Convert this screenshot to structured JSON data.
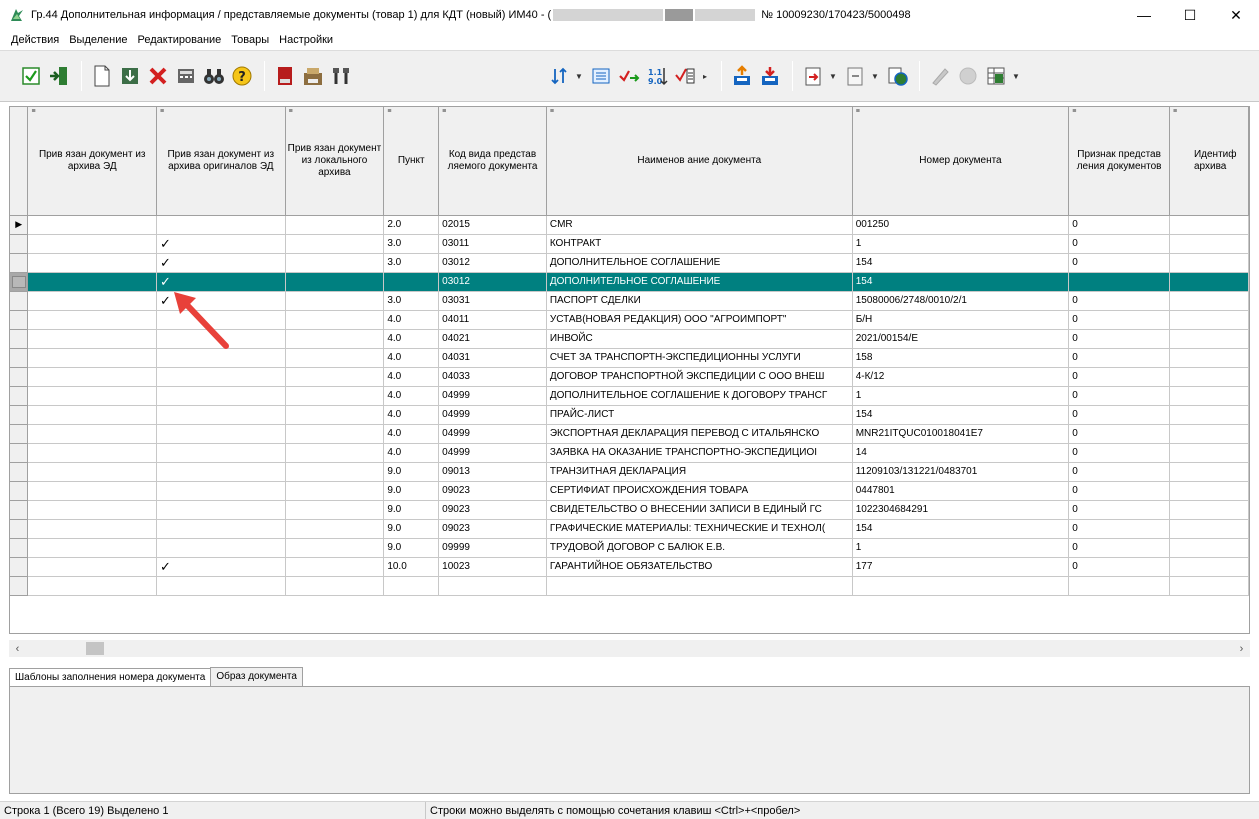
{
  "window": {
    "title_prefix": "Гр.44 Дополнительная информация / представляемые документы (товар 1) для  КДТ (новый) ИМ40 - (",
    "title_suffix": "№ 10009230/170423/5000498",
    "minimize": "—",
    "maximize": "☐",
    "close": "✕"
  },
  "menu": [
    "Действия",
    "Выделение",
    "Редактирование",
    "Товары",
    "Настройки"
  ],
  "columns": [
    "Прив язан документ из архива ЭД",
    "Прив язан документ из архива оригиналов ЭД",
    "Прив язан документ из локального архива",
    "Пункт",
    "Код вида представ ляемого документа",
    "Наименов ание документа",
    "Номер документа",
    "Признак представ ления документов",
    "Идентиф архива"
  ],
  "rows": [
    {
      "ed": "",
      "orig": "",
      "local": "",
      "punkt": "2.0",
      "code": "02015",
      "name": "CMR",
      "number": "001250",
      "sign": "0",
      "id": "",
      "current": true
    },
    {
      "ed": "",
      "orig": "✓",
      "local": "",
      "punkt": "3.0",
      "code": "03011",
      "name": "КОНТРАКТ",
      "number": "1",
      "sign": "0",
      "id": ""
    },
    {
      "ed": "",
      "orig": "✓",
      "local": "",
      "punkt": "3.0",
      "code": "03012",
      "name": "ДОПОЛНИТЕЛЬНОЕ СОГЛАШЕНИЕ",
      "number": "154",
      "sign": "0",
      "id": ""
    },
    {
      "ed": "",
      "orig": "✓",
      "local": "",
      "punkt": "",
      "code": "03012",
      "name": "ДОПОЛНИТЕЛЬНОЕ СОГЛАШЕНИЕ",
      "number": "154",
      "sign": "",
      "id": "",
      "selected": true
    },
    {
      "ed": "",
      "orig": "✓",
      "local": "",
      "punkt": "3.0",
      "code": "03031",
      "name": "ПАСПОРТ СДЕЛКИ",
      "number": "15080006/2748/0010/2/1",
      "sign": "0",
      "id": ""
    },
    {
      "ed": "",
      "orig": "",
      "local": "",
      "punkt": "4.0",
      "code": "04011",
      "name": "УСТАВ(НОВАЯ РЕДАКЦИЯ) ООО \"АГРОИМПОРТ\"",
      "number": "Б/Н",
      "sign": "0",
      "id": ""
    },
    {
      "ed": "",
      "orig": "",
      "local": "",
      "punkt": "4.0",
      "code": "04021",
      "name": "ИНВОЙС",
      "number": "2021/00154/E",
      "sign": "0",
      "id": ""
    },
    {
      "ed": "",
      "orig": "",
      "local": "",
      "punkt": "4.0",
      "code": "04031",
      "name": "СЧЕТ ЗА ТРАНСПОРТН-ЭКСПЕДИЦИОННЫ УСЛУГИ",
      "number": "158",
      "sign": "0",
      "id": ""
    },
    {
      "ed": "",
      "orig": "",
      "local": "",
      "punkt": "4.0",
      "code": "04033",
      "name": "ДОГОВОР ТРАНСПОРТНОЙ ЭКСПЕДИЦИИ С ООО ВНЕШ",
      "number": "4-К/12",
      "sign": "0",
      "id": ""
    },
    {
      "ed": "",
      "orig": "",
      "local": "",
      "punkt": "4.0",
      "code": "04999",
      "name": "ДОПОЛНИТЕЛЬНОЕ СОГЛАШЕНИЕ К ДОГОВОРУ ТРАНСГ",
      "number": "1",
      "sign": "0",
      "id": ""
    },
    {
      "ed": "",
      "orig": "",
      "local": "",
      "punkt": "4.0",
      "code": "04999",
      "name": "ПРАЙС-ЛИСТ",
      "number": "154",
      "sign": "0",
      "id": ""
    },
    {
      "ed": "",
      "orig": "",
      "local": "",
      "punkt": "4.0",
      "code": "04999",
      "name": "ЭКСПОРТНАЯ ДЕКЛАРАЦИЯ ПЕРЕВОД С ИТАЛЬЯНСКО",
      "number": "MNR21ITQUC010018041E7",
      "sign": "0",
      "id": ""
    },
    {
      "ed": "",
      "orig": "",
      "local": "",
      "punkt": "4.0",
      "code": "04999",
      "name": "ЗАЯВКА НА ОКАЗАНИЕ ТРАНСПОРТНО-ЭКСПЕДИЦИОІ",
      "number": "14",
      "sign": "0",
      "id": ""
    },
    {
      "ed": "",
      "orig": "",
      "local": "",
      "punkt": "9.0",
      "code": "09013",
      "name": "ТРАНЗИТНАЯ ДЕКЛАРАЦИЯ",
      "number": "11209103/131221/0483701",
      "sign": "0",
      "id": ""
    },
    {
      "ed": "",
      "orig": "",
      "local": "",
      "punkt": "9.0",
      "code": "09023",
      "name": "СЕРТИФИАТ ПРОИСХОЖДЕНИЯ ТОВАРА",
      "number": "0447801",
      "sign": "0",
      "id": ""
    },
    {
      "ed": "",
      "orig": "",
      "local": "",
      "punkt": "9.0",
      "code": "09023",
      "name": "СВИДЕТЕЛЬСТВО О ВНЕСЕНИИ ЗАПИСИ В ЕДИНЫЙ ГС",
      "number": "1022304684291",
      "sign": "0",
      "id": ""
    },
    {
      "ed": "",
      "orig": "",
      "local": "",
      "punkt": "9.0",
      "code": "09023",
      "name": "ГРАФИЧЕСКИЕ МАТЕРИАЛЫ: ТЕХНИЧЕСКИЕ И ТЕХНОЛ(",
      "number": "154",
      "sign": "0",
      "id": ""
    },
    {
      "ed": "",
      "orig": "",
      "local": "",
      "punkt": "9.0",
      "code": "09999",
      "name": "ТРУДОВОЙ ДОГОВОР С БАЛЮК Е.В.",
      "number": "1",
      "sign": "0",
      "id": ""
    },
    {
      "ed": "",
      "orig": "✓",
      "local": "",
      "punkt": "10.0",
      "code": "10023",
      "name": "ГАРАНТИЙНОЕ ОБЯЗАТЕЛЬСТВО",
      "number": "177",
      "sign": "0",
      "id": ""
    },
    {
      "ed": "",
      "orig": "",
      "local": "",
      "punkt": "",
      "code": "",
      "name": "",
      "number": "",
      "sign": "",
      "id": ""
    }
  ],
  "tabs": [
    "Шаблоны заполнения номера документа",
    "Образ документа"
  ],
  "status": {
    "left": "Строка 1 (Всего 19) Выделено 1",
    "right": "Строки можно выделять с помощью сочетания клавиш <Ctrl>+<пробел>"
  },
  "colors": {
    "selection": "#008080",
    "annotation_arrow": "#e8413a"
  }
}
